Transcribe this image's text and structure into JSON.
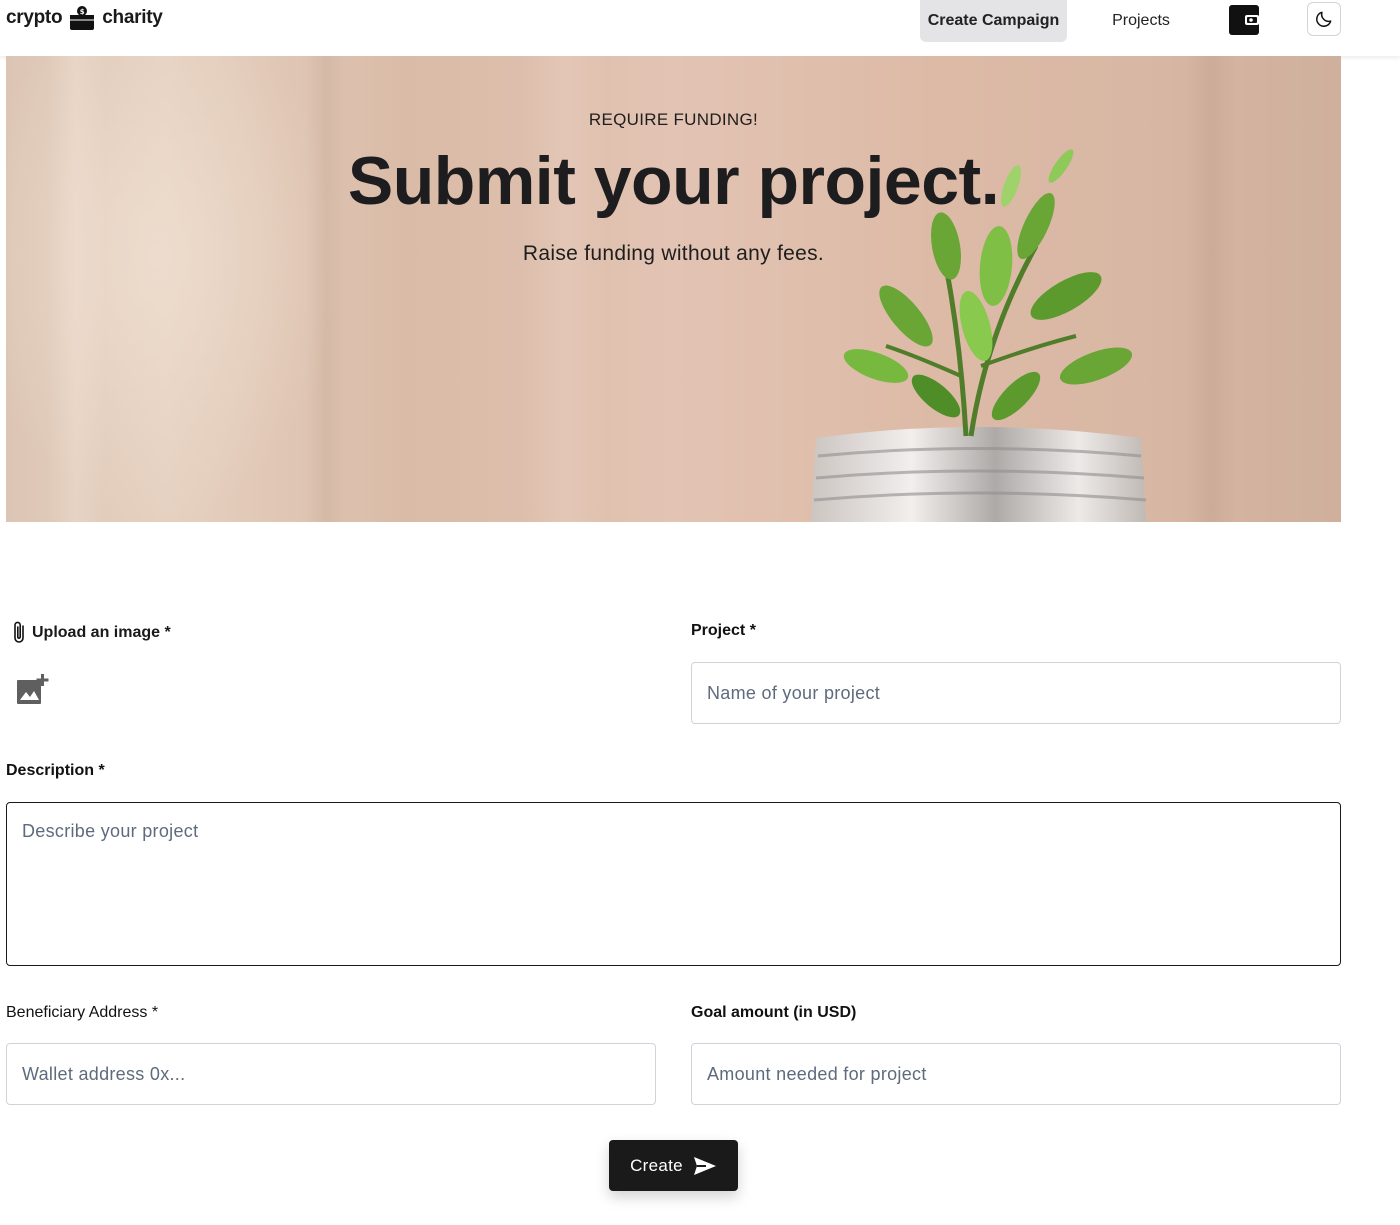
{
  "header": {
    "logo_left": "crypto",
    "logo_right": "charity",
    "nav": {
      "create_campaign": "Create Campaign",
      "projects": "Projects"
    },
    "icons": {
      "wallet": "wallet-icon",
      "theme": "moon-icon"
    }
  },
  "hero": {
    "kicker": "REQUIRE FUNDING!",
    "title": "Submit your project.",
    "subtitle": "Raise funding without any fees."
  },
  "form": {
    "upload_label": "Upload an image *",
    "project_label": "Project *",
    "project_placeholder": "Name of your project",
    "description_label": "Description *",
    "description_placeholder": "Describe your project",
    "beneficiary_label": "Beneficiary Address *",
    "beneficiary_placeholder": "Wallet address 0x...",
    "goal_label": "Goal amount (in USD)",
    "goal_placeholder": "Amount needed for project",
    "submit_label": "Create"
  },
  "colors": {
    "primary": "#1a1a1a",
    "nav_active_bg": "#e4e4e7",
    "placeholder": "#5e6b7d",
    "input_border": "#cfd4da"
  }
}
